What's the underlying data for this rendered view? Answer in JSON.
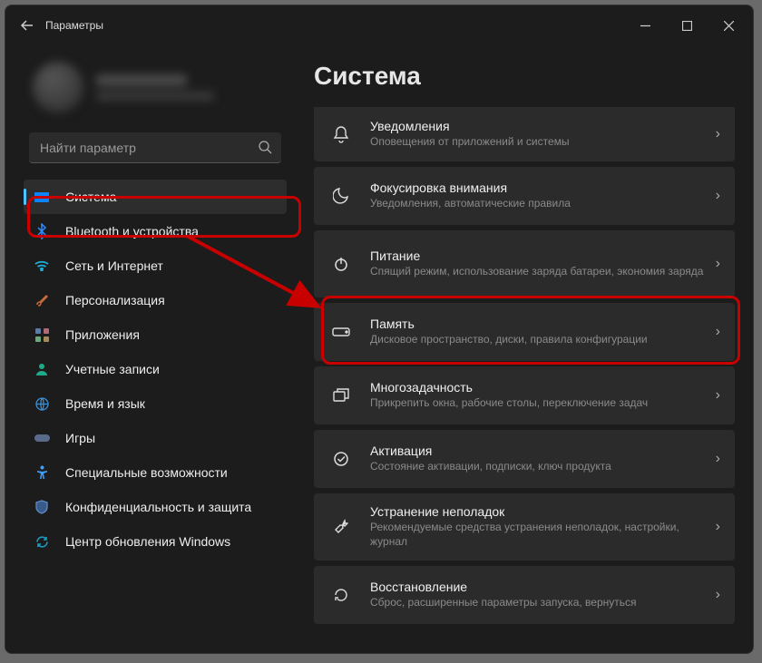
{
  "window": {
    "title": "Параметры"
  },
  "search": {
    "placeholder": "Найти параметр"
  },
  "sidebar": {
    "items": [
      {
        "label": "Система"
      },
      {
        "label": "Bluetooth и устройства"
      },
      {
        "label": "Сеть и Интернет"
      },
      {
        "label": "Персонализация"
      },
      {
        "label": "Приложения"
      },
      {
        "label": "Учетные записи"
      },
      {
        "label": "Время и язык"
      },
      {
        "label": "Игры"
      },
      {
        "label": "Специальные возможности"
      },
      {
        "label": "Конфиденциальность и защита"
      },
      {
        "label": "Центр обновления Windows"
      }
    ]
  },
  "main": {
    "heading": "Система",
    "cards": [
      {
        "title": "Уведомления",
        "sub": "Оповещения от приложений и системы"
      },
      {
        "title": "Фокусировка внимания",
        "sub": "Уведомления, автоматические правила"
      },
      {
        "title": "Питание",
        "sub": "Спящий режим, использование заряда батареи, экономия заряда"
      },
      {
        "title": "Память",
        "sub": "Дисковое пространство, диски, правила конфигурации"
      },
      {
        "title": "Многозадачность",
        "sub": "Прикрепить окна, рабочие столы, переключение задач"
      },
      {
        "title": "Активация",
        "sub": "Состояние активации, подписки, ключ продукта"
      },
      {
        "title": "Устранение неполадок",
        "sub": "Рекомендуемые средства устранения неполадок, настройки, журнал"
      },
      {
        "title": "Восстановление",
        "sub": "Сброс, расширенные параметры запуска, вернуться"
      }
    ]
  }
}
